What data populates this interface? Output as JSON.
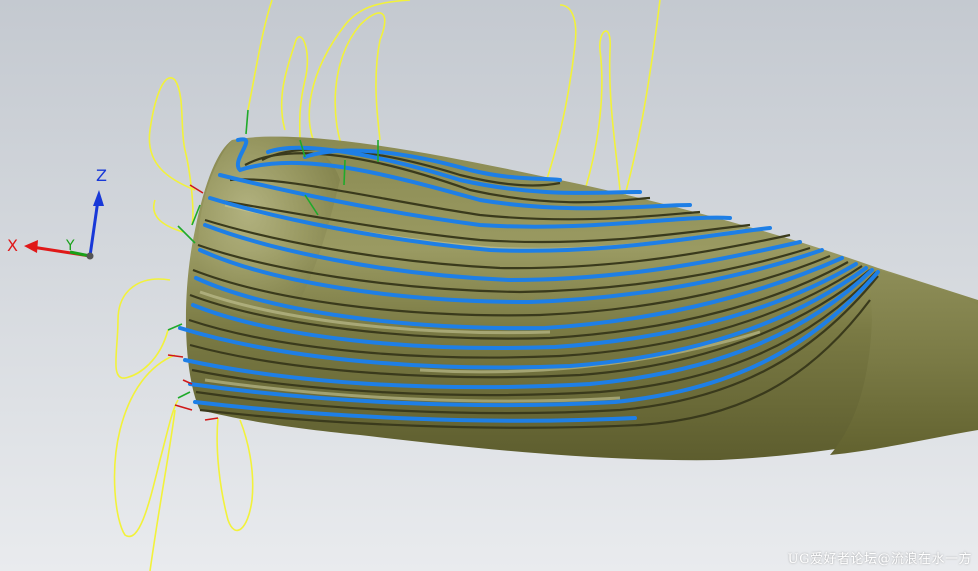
{
  "viewport": {
    "background_top": "#c4c9d0",
    "background_bottom": "#e9ebee"
  },
  "model": {
    "body_color": "#7d7d45",
    "groove_color": "#3e3e1f",
    "highlight_color": "#c6c697",
    "toolpath_cut_color": "#1e7fe6",
    "toolpath_noncut_color": "#f2f23a",
    "toolpath_engage_color": "#1faa2a",
    "toolpath_retract_color": "#d01818"
  },
  "triad": {
    "x_label": "X",
    "y_label": "Y",
    "z_label": "Z",
    "x_color": "#e01818",
    "y_color": "#18a018",
    "z_color": "#1838d8"
  },
  "watermark": "UG爱好者论坛@流浪在水一方"
}
